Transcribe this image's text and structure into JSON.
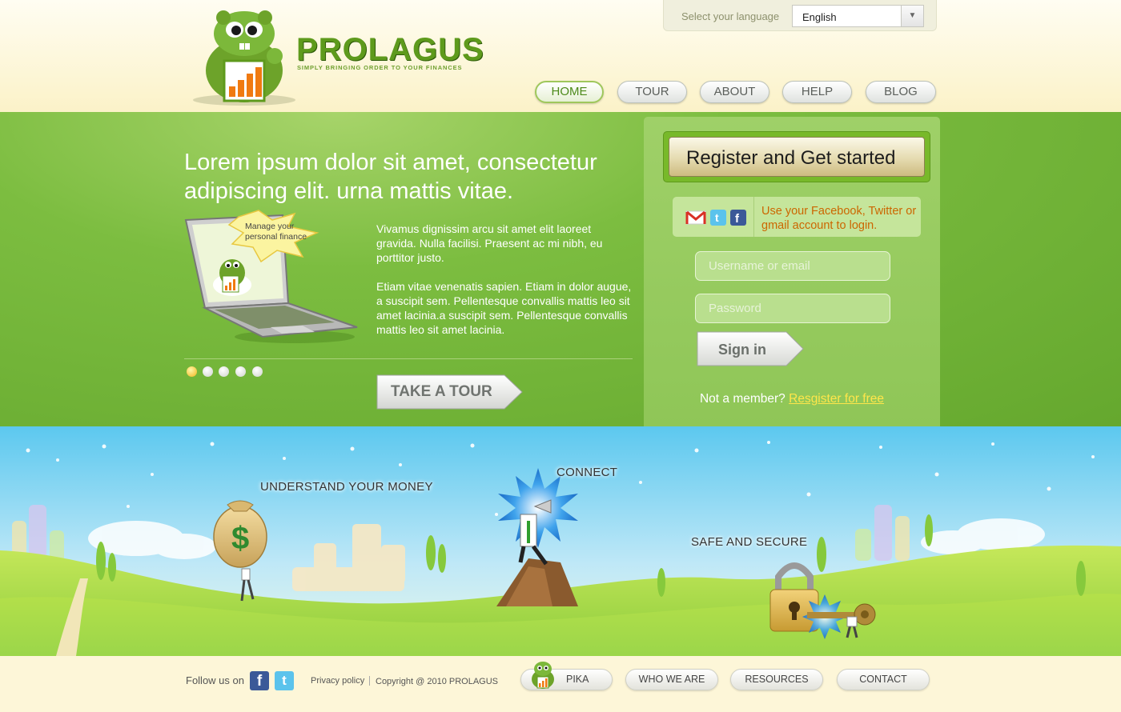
{
  "header": {
    "brand": "PROLAGUS",
    "tagline": "SIMPLY BRINGING ORDER TO YOUR FINANCES",
    "language": {
      "label": "Select your language",
      "value": "English"
    },
    "nav": [
      {
        "label": "HOME",
        "active": true
      },
      {
        "label": "TOUR",
        "active": false
      },
      {
        "label": "ABOUT",
        "active": false
      },
      {
        "label": "HELP",
        "active": false
      },
      {
        "label": "BLOG",
        "active": false
      }
    ]
  },
  "hero": {
    "title": "Lorem ipsum dolor sit amet, consectetur adipiscing elit. urna mattis vitae.",
    "bubble_text": "Manage your personal finance",
    "paragraph1": "Vivamus dignissim arcu sit amet elit laoreet gravida. Nulla facilisi. Praesent ac mi nibh, eu porttitor justo.",
    "paragraph2": "Etiam vitae venenatis sapien. Etiam in dolor augue, a suscipit sem. Pellentesque convallis mattis leo sit amet lacinia.a suscipit sem. Pellentesque convallis mattis leo sit amet lacinia.",
    "slides": 5,
    "active_slide": 1,
    "tour_button": "TAKE A TOUR"
  },
  "login": {
    "register_button": "Register and Get started",
    "social_text": "Use your Facebook, Twitter or gmail account to login.",
    "social_icons": [
      "gmail-icon",
      "twitter-icon",
      "facebook-icon"
    ],
    "username_placeholder": "Username or email",
    "password_placeholder": "Password",
    "signin_button": "Sign in",
    "member_prompt": "Not a member?",
    "register_link": "Resgister for free"
  },
  "scene": {
    "labels": {
      "understand": "UNDERSTAND YOUR MONEY",
      "connect": "CONNECT",
      "secure": "SAFE AND SECURE"
    },
    "money_symbol": "$"
  },
  "footer": {
    "follow_label": "Follow us on",
    "follow_icons": {
      "facebook": "f",
      "twitter": "t"
    },
    "privacy": "Privacy policy",
    "copyright": "Copyright @ 2010 PROLAGUS",
    "links": [
      "PIKA",
      "WHO WE ARE",
      "RESOURCES",
      "CONTACT"
    ]
  },
  "colors": {
    "brand_green": "#5e9a1c",
    "hero_green": "#7cbd40",
    "link_yellow": "#ffe64a",
    "social_orange": "#cc6600"
  }
}
